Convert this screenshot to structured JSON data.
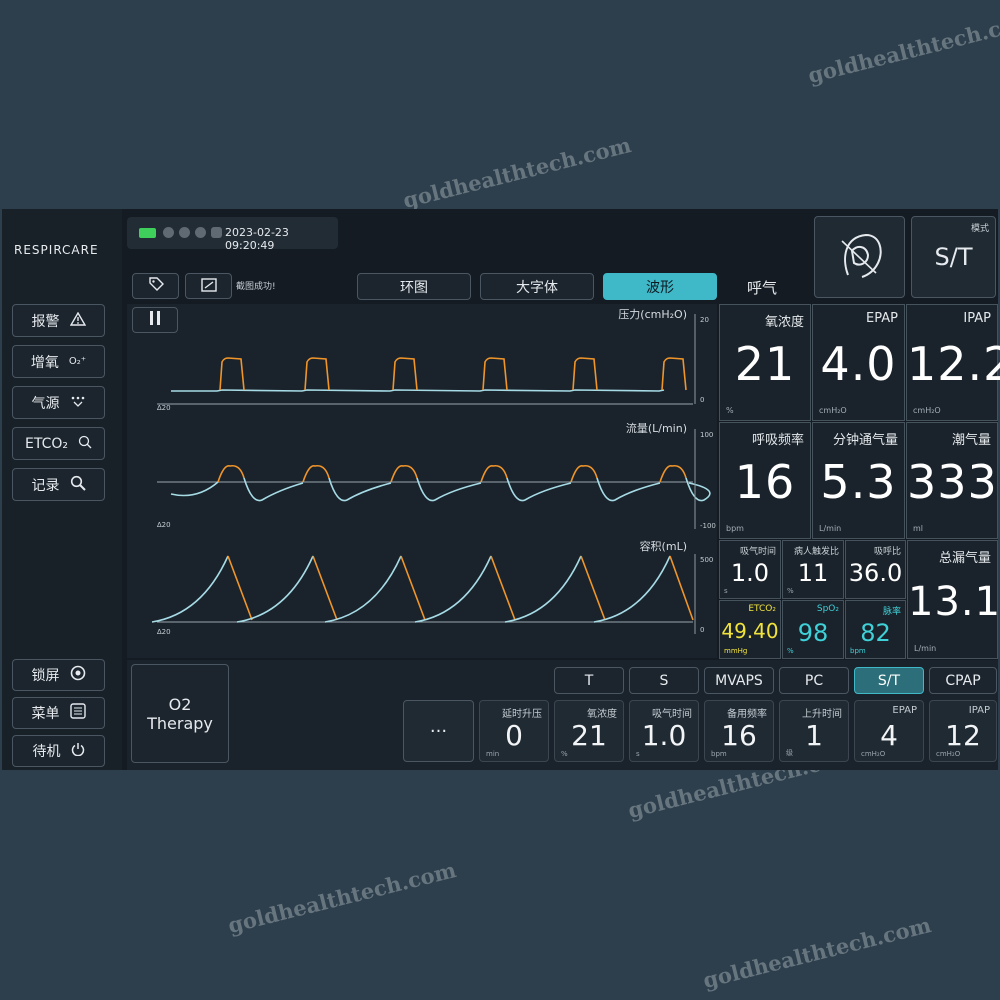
{
  "brand": {
    "logo": "RESPIRCARE"
  },
  "status_bar": {
    "datetime": "2023-02-23 09:20:49"
  },
  "colors": {
    "accent": "#3fb8c8",
    "waveform_inspiration": "#f0952a",
    "waveform_expiration": "#a6dbe6",
    "spo2": "#3fd0d8",
    "etco2": "#f2e33c"
  },
  "side_menu": [
    {
      "label": "报警",
      "icon": "warning-icon"
    },
    {
      "label": "增氧",
      "icon": "o2-icon"
    },
    {
      "label": "气源",
      "icon": "gas-source-icon"
    },
    {
      "label": "ETCO₂",
      "icon": "etco2-icon"
    },
    {
      "label": "记录",
      "icon": "search-icon"
    }
  ],
  "bottom_left_menu": [
    {
      "label": "锁屏",
      "icon": "lock-icon"
    },
    {
      "label": "菜单",
      "icon": "menu-icon"
    },
    {
      "label": "待机",
      "icon": "power-icon"
    }
  ],
  "toolbar": {
    "freeze_label": "截图成功!"
  },
  "tabs": [
    {
      "label": "环图",
      "active": false
    },
    {
      "label": "大字体",
      "active": false
    },
    {
      "label": "波形",
      "active": true
    }
  ],
  "section_title": "呼气",
  "mode_display": {
    "label": "模式",
    "value": "S/T"
  },
  "waveforms": {
    "pressure": {
      "label": "压力(cmH₂O)",
      "scale_top": "20",
      "scale_bottom": "0"
    },
    "flow": {
      "label": "流量(L/min)",
      "scale_top": "100",
      "scale_bottom": "-100"
    },
    "volume": {
      "label": "容积(mL)",
      "scale_top": "500",
      "scale_bottom": "0"
    },
    "time_marker": "∆20"
  },
  "monitor": {
    "ipap": {
      "label": "IPAP",
      "value": "12.2",
      "unit": "cmH₂O"
    },
    "epap": {
      "label": "EPAP",
      "value": "4.0",
      "unit": "cmH₂O"
    },
    "fio2": {
      "label": "氧浓度",
      "value": "21",
      "unit": "%"
    },
    "tidal_volume": {
      "label": "潮气量",
      "value": "333",
      "unit": "ml"
    },
    "minute_volume": {
      "label": "分钟通气量",
      "value": "5.3",
      "unit": "L/min"
    },
    "resp_rate": {
      "label": "呼吸频率",
      "value": "16",
      "unit": "bpm"
    },
    "total_leak": {
      "label": "总漏气量",
      "value": "13.1",
      "unit": "L/min"
    },
    "ie_ratio": {
      "label": "吸呼比",
      "value": "36.0",
      "unit": ""
    },
    "spont_ratio": {
      "label": "病人触发比",
      "value": "11",
      "unit": "%"
    },
    "insp_time": {
      "label": "吸气时间",
      "value": "1.0",
      "unit": "s"
    },
    "pulse": {
      "label": "脉率",
      "value": "82",
      "unit": "bpm"
    },
    "spo2": {
      "label": "SpO₂",
      "value": "98",
      "unit": "%"
    },
    "etco2": {
      "label": "ETCO₂",
      "value": "49.40",
      "unit": "mmHg"
    }
  },
  "modes": [
    "CPAP",
    "S/T",
    "PC",
    "MVAPS",
    "S",
    "T"
  ],
  "active_mode": "S/T",
  "settings": [
    {
      "label": "IPAP",
      "value": "12",
      "unit": "cmH₂O"
    },
    {
      "label": "EPAP",
      "value": "4",
      "unit": "cmH₂O"
    },
    {
      "label": "上升时间",
      "value": "1",
      "unit": "级"
    },
    {
      "label": "备用频率",
      "value": "16",
      "unit": "bpm"
    },
    {
      "label": "吸气时间",
      "value": "1.0",
      "unit": "s"
    },
    {
      "label": "氧浓度",
      "value": "21",
      "unit": "%"
    },
    {
      "label": "延时升压",
      "value": "0",
      "unit": "min"
    }
  ],
  "more_settings": "···",
  "o2_therapy": {
    "line1": "O2",
    "line2": "Therapy"
  },
  "watermark_text": "goldhealthtech.com"
}
